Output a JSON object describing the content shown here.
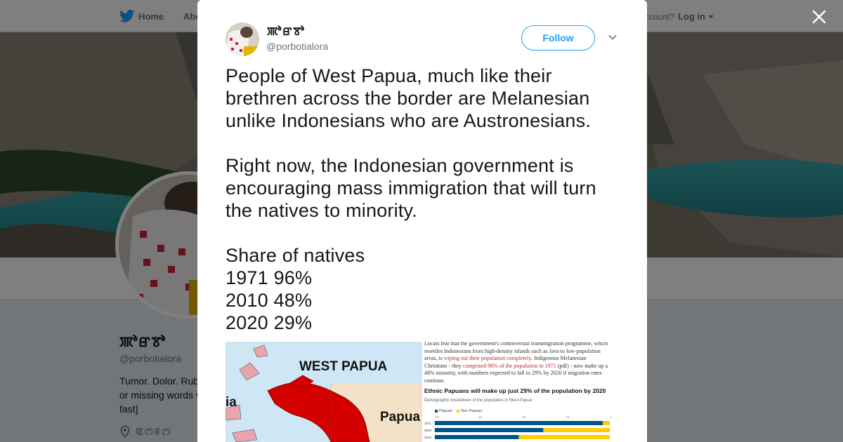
{
  "header": {
    "home_label": "Home",
    "about_label": "Abo",
    "account_question": "ccount?",
    "login_label": "Log in"
  },
  "profile": {
    "name": "ꯄꯣꯔꯕꯣ",
    "handle": "@porbotialora",
    "bio": "Tumor. Dolor. Rub or missing words v fast]",
    "location": "ꯑꯁꯝꯁ"
  },
  "modal": {
    "close_icon": "close-icon",
    "author_name": "ꯄꯣꯔꯕꯣ",
    "author_handle": "@porbotialora",
    "follow_label": "Follow",
    "tweet_paragraphs": [
      "People of West Papua, much like their brethren across the border are Melanesian unlike Indonesians who are Austronesians.",
      "Right now, the Indonesian government is encouraging mass immigration that will turn the natives to minority.",
      "Share of natives\n1971 96%\n2010 48%\n2020 29%"
    ],
    "media": {
      "map_title": "WEST PAPUA",
      "map_label_papua": "Papua",
      "map_label_left": "ia",
      "article_text_1": "Locals fear that the government's controversial transmigration programme, which resettles Indonesians from high-density islands such as Java to low-population areas, is ",
      "article_text_red_1": "wiping out their population completely",
      "article_text_2": ". Indigenous Melanesian Christians - they ",
      "article_text_red_2": "comprised 96% of the population in 1971",
      "article_text_3": " (pdf) - now make up a 48% minority, with numbers expected to fall to 29% by 2020 if migration rates continue.",
      "chart_headline": "Ethnic Papuans will make up just 29% of the population by 2020",
      "chart_subtitle": "Demographic breakdown of the population in West Papua",
      "legend": [
        "Papuan",
        "Non Papuan"
      ]
    }
  },
  "colors": {
    "twitter_blue": "#1da1f2",
    "papuan": "#005689",
    "non_papuan": "#ffce00",
    "map_land": "#d40000"
  },
  "chart_data": {
    "type": "bar",
    "title": "Ethnic Papuans will make up just 29% of the population by 2020",
    "subtitle": "Demographic breakdown of the population in West Papua",
    "categories": [
      "1971",
      "2000",
      "2010"
    ],
    "series": [
      {
        "name": "Papuan",
        "values": [
          96,
          62,
          48
        ]
      },
      {
        "name": "Non Papuan",
        "values": [
          4,
          38,
          52
        ]
      }
    ],
    "stacked": true,
    "orientation": "horizontal",
    "xlim": [
      0,
      100
    ],
    "ticks": [
      "0%",
      "25",
      "50",
      "75",
      "100"
    ]
  }
}
